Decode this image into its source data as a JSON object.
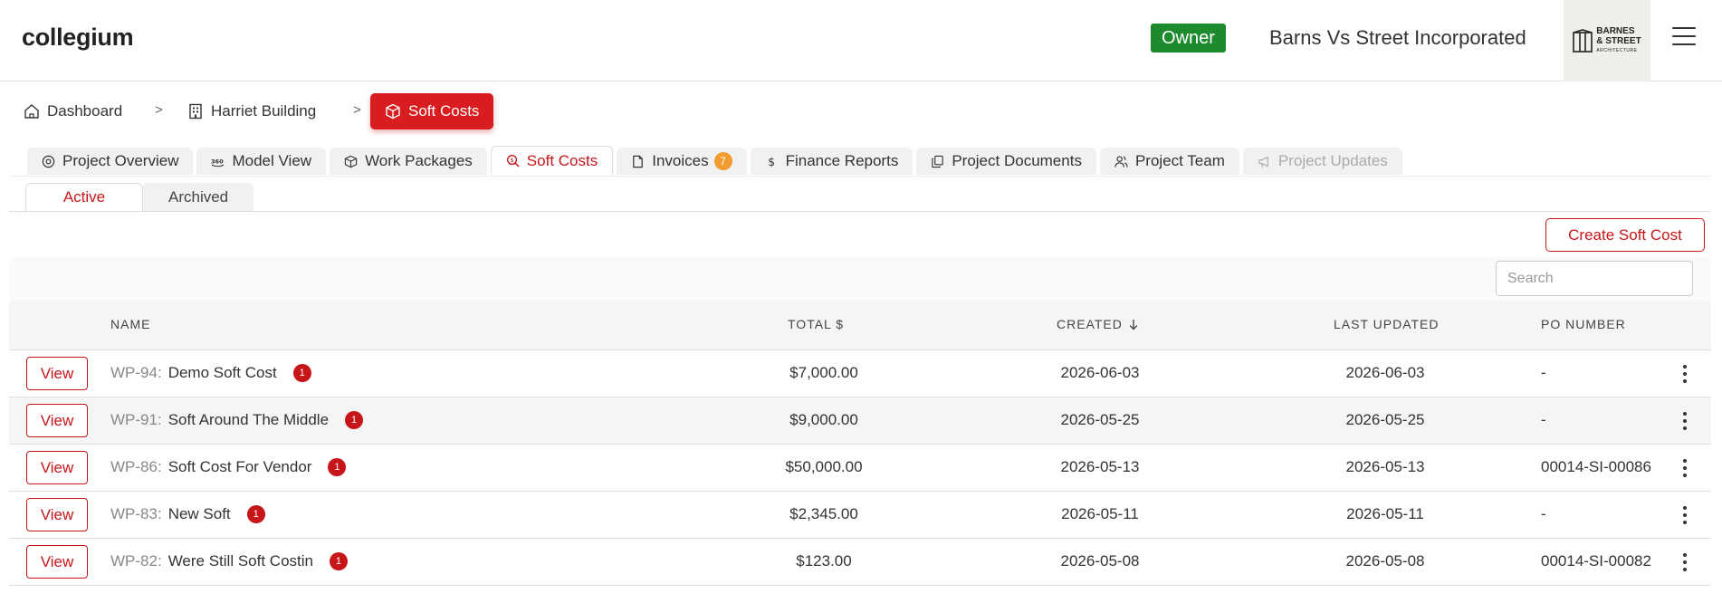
{
  "header": {
    "brand": "collegium",
    "role_badge": "Owner",
    "company": "Barns Vs Street Incorporated",
    "logo_line1": "BARNES",
    "logo_line2": "& STREET",
    "logo_line3": "ARCHITECTURE"
  },
  "breadcrumb": {
    "items": [
      {
        "label": "Dashboard",
        "icon": "home-icon"
      },
      {
        "label": "Harriet Building",
        "icon": "building-icon"
      },
      {
        "label": "Soft Costs",
        "icon": "cube-icon"
      }
    ],
    "separator": ">"
  },
  "tabs": [
    {
      "label": "Project Overview",
      "icon": "overview-icon"
    },
    {
      "label": "Model View",
      "icon": "360-icon"
    },
    {
      "label": "Work Packages",
      "icon": "package-icon"
    },
    {
      "label": "Soft Costs",
      "icon": "search-dollar-icon",
      "selected": true
    },
    {
      "label": "Invoices",
      "icon": "file-icon",
      "count": "7"
    },
    {
      "label": "Finance Reports",
      "icon": "dollar-icon"
    },
    {
      "label": "Project Documents",
      "icon": "documents-icon"
    },
    {
      "label": "Project Team",
      "icon": "team-icon"
    },
    {
      "label": "Project Updates",
      "icon": "megaphone-icon",
      "disabled": true
    }
  ],
  "subtabs": [
    "Active",
    "Archived"
  ],
  "toolbar": {
    "create_label": "Create Soft Cost",
    "search_placeholder": "Search"
  },
  "table": {
    "headers": {
      "name": "NAME",
      "total": "TOTAL $",
      "created": "CREATED",
      "updated": "LAST UPDATED",
      "po": "PO NUMBER"
    },
    "view_label": "View",
    "rows": [
      {
        "code": "WP-94:",
        "name": "Demo Soft Cost",
        "badge": "1",
        "total": "$7,000.00",
        "created": "2026-06-03",
        "updated": "2026-06-03",
        "po": "-"
      },
      {
        "code": "WP-91:",
        "name": "Soft Around The Middle",
        "badge": "1",
        "total": "$9,000.00",
        "created": "2026-05-25",
        "updated": "2026-05-25",
        "po": "-"
      },
      {
        "code": "WP-86:",
        "name": "Soft Cost For Vendor",
        "badge": "1",
        "total": "$50,000.00",
        "created": "2026-05-13",
        "updated": "2026-05-13",
        "po": "00014-SI-00086"
      },
      {
        "code": "WP-83:",
        "name": "New Soft",
        "badge": "1",
        "total": "$2,345.00",
        "created": "2026-05-11",
        "updated": "2026-05-11",
        "po": "-"
      },
      {
        "code": "WP-82:",
        "name": "Were Still Soft Costin",
        "badge": "1",
        "total": "$123.00",
        "created": "2026-05-08",
        "updated": "2026-05-08",
        "po": "00014-SI-00082"
      }
    ]
  },
  "colors": {
    "accent": "#c6161a",
    "owner_badge": "#1e8a2e",
    "invoice_count": "#f29b30"
  }
}
